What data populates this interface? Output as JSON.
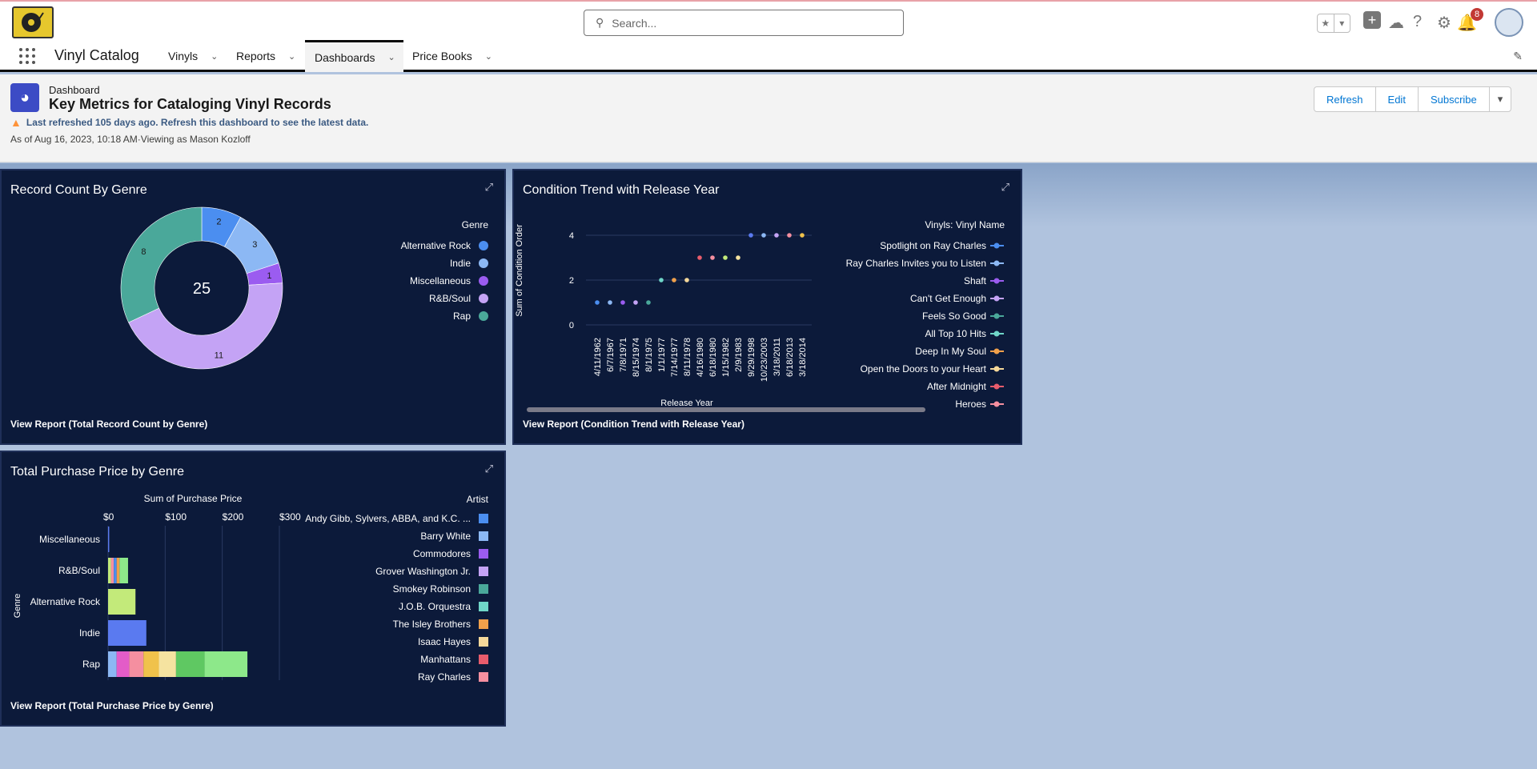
{
  "global": {
    "search_placeholder": "Search...",
    "notification_count": "8"
  },
  "nav": {
    "app_name": "Vinyl Catalog",
    "tabs": [
      {
        "label": "Vinyls"
      },
      {
        "label": "Reports"
      },
      {
        "label": "Dashboards",
        "active": true
      },
      {
        "label": "Price Books"
      }
    ]
  },
  "header": {
    "object_label": "Dashboard",
    "title": "Key Metrics for Cataloging Vinyl Records",
    "warning": "Last refreshed 105 days ago. Refresh this dashboard to see the latest data.",
    "as_of": "As of Aug 16, 2023, 10:18 AM·Viewing as Mason Kozloff",
    "buttons": {
      "refresh": "Refresh",
      "edit": "Edit",
      "subscribe": "Subscribe"
    }
  },
  "colors": {
    "card_bg": "#0c1a3a",
    "accent": "#0176d3",
    "series": [
      "#4b8ef0",
      "#8cb8f4",
      "#9b5cf0",
      "#c4a3f5",
      "#4aa89a",
      "#6fd6c8",
      "#f0a04b",
      "#f5d89a",
      "#e85c6c",
      "#f58fa0",
      "#c3ea7a",
      "#e35cc8",
      "#f0c24b",
      "#f5e3a0",
      "#5fc862",
      "#8de88a",
      "#5a7af0"
    ]
  },
  "widgets": {
    "donut": {
      "title": "Record Count By Genre",
      "link": "View Report (Total Record Count by Genre)",
      "chart_data": {
        "type": "pie",
        "title": "Record Count",
        "legend_title": "Genre",
        "total": "25",
        "categories": [
          "Alternative Rock",
          "Indie",
          "Miscellaneous",
          "R&B/Soul",
          "Rap"
        ],
        "values": [
          2,
          3,
          1,
          11,
          8
        ],
        "colors": [
          "#4b8ef0",
          "#8cb8f4",
          "#9b5cf0",
          "#c4a3f5",
          "#4aa89a"
        ]
      }
    },
    "scatter": {
      "title": "Condition Trend with Release Year",
      "link": "View Report (Condition Trend with Release Year)",
      "chart_data": {
        "type": "scatter",
        "xlabel": "Release Year",
        "ylabel": "Sum of Condition Order",
        "legend_title": "Vinyls: Vinyl Name",
        "ylim": [
          0,
          4
        ],
        "yticks": [
          0,
          2,
          4
        ],
        "x": [
          "4/11/1962",
          "6/7/1967",
          "7/8/1971",
          "8/15/1974",
          "8/1/1975",
          "1/1/1977",
          "7/14/1977",
          "8/11/1978",
          "4/16/1980",
          "6/18/1980",
          "1/15/1982",
          "2/9/1983",
          "9/29/1998",
          "10/23/2003",
          "3/18/2011",
          "6/18/2013",
          "3/18/2014"
        ],
        "y": [
          1,
          1,
          1,
          1,
          1,
          2,
          2,
          2,
          3,
          3,
          3,
          3,
          4,
          4,
          4,
          4,
          4
        ],
        "point_colors": [
          "#4b8ef0",
          "#8cb8f4",
          "#9b5cf0",
          "#c4a3f5",
          "#4aa89a",
          "#6fd6c8",
          "#f0a04b",
          "#f5d89a",
          "#e85c6c",
          "#f58fa0",
          "#c3ea7a",
          "#f5e3a0",
          "#5a7af0",
          "#8cb8f4",
          "#c4a3f5",
          "#f58fa0",
          "#f0c24b"
        ],
        "legend": [
          "Spotlight on Ray Charles",
          "Ray Charles Invites you to Listen",
          "Shaft",
          "Can't Get Enough",
          "Feels So Good",
          "All Top 10 Hits",
          "Deep In My Soul",
          "Open the Doors to your Heart",
          "After Midnight",
          "Heroes"
        ],
        "legend_colors": [
          "#4b8ef0",
          "#8cb8f4",
          "#9b5cf0",
          "#c4a3f5",
          "#4aa89a",
          "#6fd6c8",
          "#f0a04b",
          "#f5d89a",
          "#e85c6c",
          "#f58fa0"
        ]
      }
    },
    "bar": {
      "title": "Total Purchase Price by Genre",
      "link": "View Report (Total Purchase Price by Genre)",
      "chart_data": {
        "type": "bar",
        "orientation": "horizontal",
        "stacked": true,
        "title": "Sum of Purchase Price",
        "ylabel": "Genre",
        "legend_title": "Artist",
        "xlim": [
          0,
          300
        ],
        "xticks": [
          "$0",
          "$100",
          "$200",
          "$300"
        ],
        "categories": [
          "Miscellaneous",
          "R&B/Soul",
          "Alternative Rock",
          "Indie",
          "Rap"
        ],
        "segments": [
          [
            {
              "value": 2,
              "color": "#5a7af0"
            }
          ],
          [
            {
              "value": 5,
              "color": "#c3ea7a"
            },
            {
              "value": 5,
              "color": "#f58fa0"
            },
            {
              "value": 5,
              "color": "#4b8ef0"
            },
            {
              "value": 5,
              "color": "#f0a04b"
            },
            {
              "value": 15,
              "color": "#8de88a"
            }
          ],
          [
            {
              "value": 48,
              "color": "#c3ea7a"
            }
          ],
          [
            {
              "value": 67,
              "color": "#5a7af0"
            }
          ],
          [
            {
              "value": 15,
              "color": "#8cb8f4"
            },
            {
              "value": 22,
              "color": "#e35cc8"
            },
            {
              "value": 25,
              "color": "#f58fa0"
            },
            {
              "value": 27,
              "color": "#f0c24b"
            },
            {
              "value": 30,
              "color": "#f5e3a0"
            },
            {
              "value": 50,
              "color": "#5fc862"
            },
            {
              "value": 75,
              "color": "#8de88a"
            }
          ]
        ],
        "legend": [
          "Andy Gibb, Sylvers, ABBA, and K.C. ...",
          "Barry White",
          "Commodores",
          "Grover Washington Jr.",
          "Smokey Robinson",
          "J.O.B. Orquestra",
          "The Isley Brothers",
          "Isaac Hayes",
          "Manhattans",
          "Ray Charles"
        ],
        "legend_colors": [
          "#4b8ef0",
          "#8cb8f4",
          "#9b5cf0",
          "#c4a3f5",
          "#4aa89a",
          "#6fd6c8",
          "#f0a04b",
          "#f5d89a",
          "#e85c6c",
          "#f58fa0"
        ]
      }
    }
  }
}
